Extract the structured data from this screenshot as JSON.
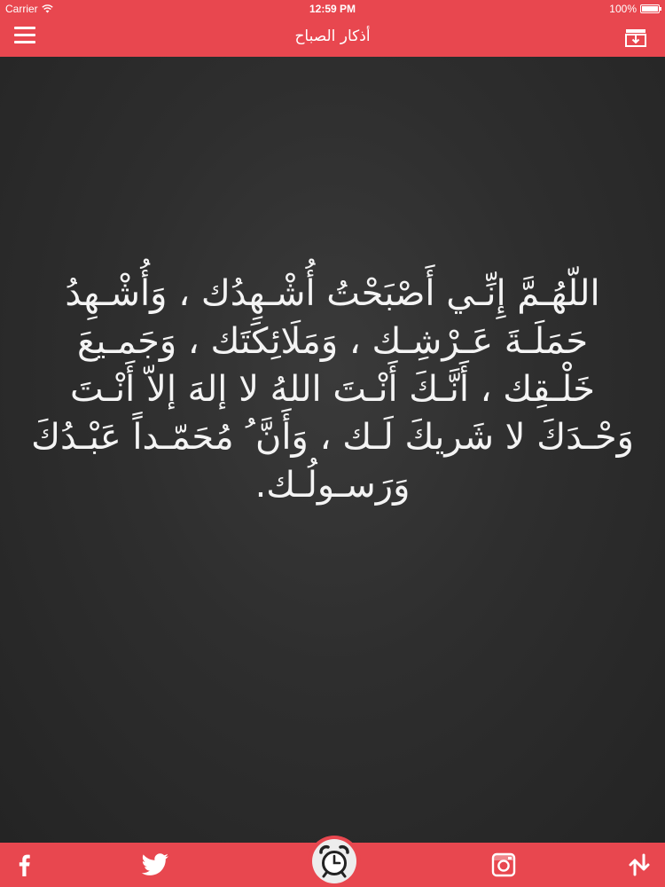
{
  "status_bar": {
    "carrier": "Carrier",
    "time": "12:59 PM",
    "battery": "100%",
    "battery_level": 1.0,
    "wifi_icon": "wifi-icon"
  },
  "nav_bar": {
    "title": "أذكار الصباح",
    "menu_icon": "hamburger-menu-icon",
    "download_icon": "download-tray-icon"
  },
  "content": {
    "dhikr": "اللّهُـمَّ إِنِّـي أَصْبَحْتُ أُشْـهِدُك ، وَأُشْـهِدُ حَمَلَـةَ عَـرْشِـك ، وَمَلَائِكَتَك ، وَجَمـيعَ خَلْـقِك ، أَنَّـكَ أَنْـتَ اللهُ لا إلهَ إلاّ أَنْـتَ وَحْـدَكَ لا شَريكَ لَـك ، وَأَنَّ ُ مُحَمّـداً عَبْـدُكَ وَرَسـولُـك."
  },
  "tab_bar": {
    "facebook_icon": "facebook-icon",
    "twitter_icon": "twitter-icon",
    "alarm_icon": "alarm-clock-icon",
    "instagram_icon": "instagram-icon",
    "share_icon": "swap-arrows-icon"
  },
  "colors": {
    "accent": "#e8474f",
    "board": "#2b2b2b",
    "text": "#f4f4f4"
  }
}
